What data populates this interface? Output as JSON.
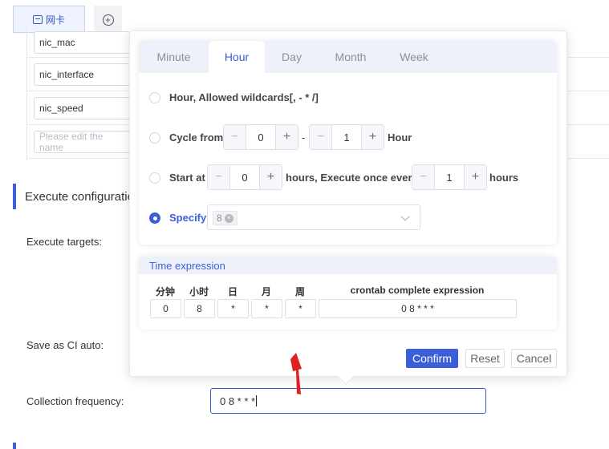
{
  "top_tab": {
    "icon": "network-card-icon",
    "label": "网卡"
  },
  "add_tab_icon": "add-circle-icon",
  "fields_table": {
    "rows": [
      {
        "value": "nic_mac",
        "placeholder": ""
      },
      {
        "value": "nic_interface",
        "placeholder": ""
      },
      {
        "value": "nic_speed",
        "placeholder": ""
      },
      {
        "value": "",
        "placeholder": "Please edit the name"
      }
    ]
  },
  "execute_section": {
    "title": "Execute configuration",
    "execute_targets_label": "Execute targets:",
    "save_as_ci_label": "Save as CI auto:",
    "collection_frequency_label": "Collection frequency:",
    "collection_frequency_value": "0 8 * * *"
  },
  "cron_popover": {
    "tabs": [
      "Minute",
      "Hour",
      "Day",
      "Month",
      "Week"
    ],
    "active_tab": "Hour",
    "options": {
      "wildcard": {
        "label": "Hour, Allowed wildcards[, - * /]",
        "selected": false
      },
      "cycle": {
        "prefix": "Cycle from",
        "from": "0",
        "dash": "-",
        "to": "1",
        "suffix": "Hour",
        "selected": false
      },
      "start": {
        "prefix": "Start at",
        "start": "0",
        "middle": "hours, Execute once every",
        "every": "1",
        "suffix": "hours",
        "selected": false
      },
      "specify": {
        "label": "Specify",
        "tags": [
          "8"
        ],
        "selected": true
      }
    },
    "stepper_minus": "−",
    "stepper_plus": "+",
    "time_expression": {
      "title": "Time expression",
      "columns": [
        "分钟",
        "小时",
        "日",
        "月",
        "周"
      ],
      "values": [
        "0",
        "8",
        "*",
        "*",
        "*"
      ],
      "complete_label": "crontab complete expression",
      "complete_value": "0 8 * * *"
    },
    "buttons": {
      "confirm": "Confirm",
      "reset": "Reset",
      "cancel": "Cancel"
    }
  },
  "colors": {
    "primary": "#3b5fd9",
    "annotation_arrow": "#e02020"
  }
}
